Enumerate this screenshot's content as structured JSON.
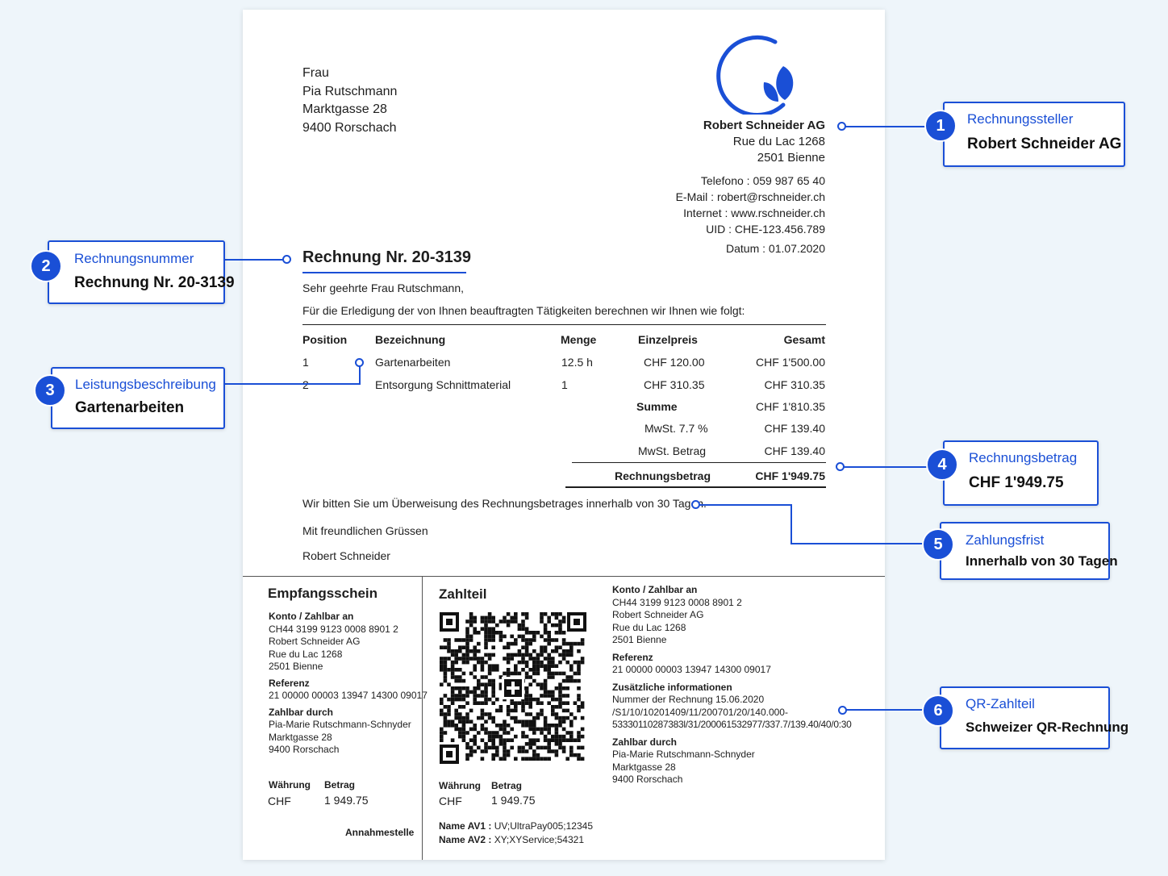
{
  "recipient": [
    "Frau",
    "Pia Rutschmann",
    "Marktgasse 28",
    "9400 Rorschach"
  ],
  "sender": {
    "name": "Robert Schneider AG",
    "street": "Rue du Lac 1268",
    "city": "2501 Bienne",
    "contact": [
      {
        "label": "Telefono :",
        "value": "059 987 65 40"
      },
      {
        "label": "E-Mail :",
        "value": "robert@rschneider.ch"
      },
      {
        "label": "Internet :",
        "value": "www.rschneider.ch"
      },
      {
        "label": "UID :",
        "value": "CHE-123.456.789"
      },
      {
        "label": "Datum :",
        "value": "01.07.2020"
      }
    ]
  },
  "invoice": {
    "title": "Rechnung Nr. 20-3139",
    "greeting": "Sehr geehrte Frau Rutschmann,",
    "intro": "Für die Erledigung der von Ihnen beauftragten Tätigkeiten berechnen wir Ihnen wie folgt:",
    "table": {
      "headers": [
        "Position",
        "Bezeichnung",
        "Menge",
        "Einzelpreis",
        "Gesamt"
      ],
      "rows": [
        [
          "1",
          "Gartenarbeiten",
          "12.5 h",
          "CHF 120.00",
          "CHF 1'500.00"
        ],
        [
          "2",
          "Entsorgung Schnittmaterial",
          "1",
          "CHF 310.35",
          "CHF 310.35"
        ]
      ]
    },
    "summary": [
      {
        "label": "Summe",
        "value": "CHF 1'810.35"
      },
      {
        "label": "MwSt. 7.7 %",
        "value": "CHF 139.40"
      },
      {
        "label": "MwSt. Betrag",
        "value": "CHF 139.40"
      }
    ],
    "total_label": "Rechnungsbetrag",
    "total_value": "CHF 1'949.75",
    "payment_note": "Wir bitten Sie um Überweisung des Rechnungsbetrages innerhalb von 30 Tagen.",
    "closing": "Mit freundlichen Grüssen",
    "signature": "Robert Schneider"
  },
  "receipt": {
    "title": "Empfangsschein",
    "account_heading": "Konto / Zahlbar an",
    "account_lines": [
      "CH44 3199 9123 0008 8901 2",
      "Robert Schneider AG",
      "Rue du Lac 1268",
      "2501 Bienne"
    ],
    "reference_heading": "Referenz",
    "reference": "21 00000 00003 13947 14300 09017",
    "payer_heading": "Zahlbar durch",
    "payer_lines": [
      "Pia-Marie Rutschmann-Schnyder",
      "Marktgasse 28",
      "9400 Rorschach"
    ],
    "currency_heading": "Währung",
    "currency": "CHF",
    "amount_heading": "Betrag",
    "amount": "1 949.75",
    "acceptance": "Annahmestelle"
  },
  "payment_part": {
    "title": "Zahlteil",
    "currency_heading": "Währung",
    "currency": "CHF",
    "amount_heading": "Betrag",
    "amount": "1 949.75",
    "av1_label": "Name AV1 :",
    "av1_value": "UV;UltraPay005;12345",
    "av2_label": "Name AV2 :",
    "av2_value": "XY;XYService;54321",
    "account_heading": "Konto / Zahlbar an",
    "account_lines": [
      "CH44 3199 9123 0008 8901 2",
      "Robert Schneider AG",
      "Rue du Lac 1268",
      "2501 Bienne"
    ],
    "reference_heading": "Referenz",
    "reference": "21 00000 00003 13947 14300 09017",
    "info_heading": "Zusätzliche informationen",
    "info_lines": [
      "Nummer der Rechnung 15.06.2020",
      "/S1/10/10201409/11/200701/20/140.000-",
      "53330110287383l/31/200061532977/337.7/139.40/40/0:30"
    ],
    "payer_heading": "Zahlbar durch",
    "payer_lines": [
      "Pia-Marie Rutschmann-Schnyder",
      "Marktgasse 28",
      "9400 Rorschach"
    ]
  },
  "callouts": [
    {
      "number": "1",
      "label": "Rechnungssteller",
      "value": "Robert Schneider AG"
    },
    {
      "number": "2",
      "label": "Rechnungsnummer",
      "value": "Rechnung Nr. 20-3139"
    },
    {
      "number": "3",
      "label": "Leistungsbeschreibung",
      "value": "Gartenarbeiten"
    },
    {
      "number": "4",
      "label": "Rechnungsbetrag",
      "value": "CHF 1'949.75"
    },
    {
      "number": "5",
      "label": "Zahlungsfrist",
      "value": "Innerhalb von 30 Tagen"
    },
    {
      "number": "6",
      "label": "QR-Zahlteil",
      "value": "Schweizer QR-Rechnung"
    }
  ],
  "colors": {
    "accent": "#1a4fd6",
    "background": "#eef5fa"
  },
  "icons": {
    "logo": "leaf-crescent-logo",
    "qr": "swiss-qr-code"
  }
}
